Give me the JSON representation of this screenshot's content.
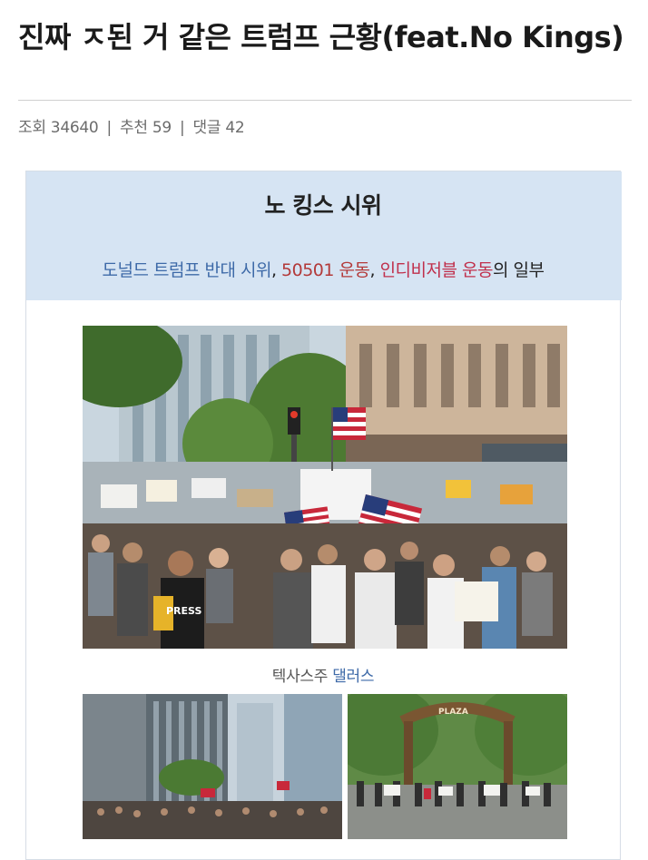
{
  "post": {
    "title": "진짜 ㅈ된 거 같은 트럼프 근황(feat.No Kings)",
    "views_label": "조회",
    "views": "34640",
    "recommend_label": "추천",
    "recommends": "59",
    "comments_label": "댓글",
    "comments": "42",
    "separator": "|"
  },
  "card": {
    "heading": "노 킹스 시위",
    "sub_part1": "도널드 트럼프 반대 시위",
    "sub_comma1": ", ",
    "sub_part2": "50501 운동",
    "sub_comma2": ", ",
    "sub_part3": "인디비저블 운동",
    "sub_tail": "의 일부",
    "colors": {
      "header_bg": "#d6e4f3",
      "link_blue": "#3e6aa8",
      "link_red": "#b33a3a",
      "link_pink": "#c0304c"
    }
  },
  "photos": {
    "main_caption_prefix": "텍사스주 ",
    "main_caption_link": "댈러스",
    "main_sign_text": "PRESS",
    "gate_sign_text": "PLAZA"
  }
}
